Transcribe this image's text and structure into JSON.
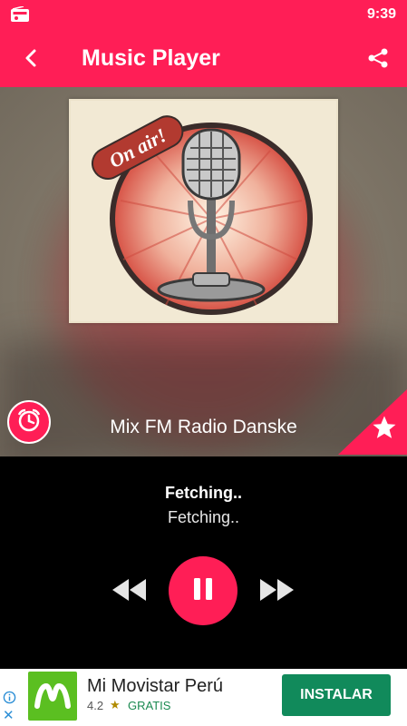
{
  "status_bar": {
    "time": "9:39",
    "icon": "radio-icon"
  },
  "app_bar": {
    "title": "Music Player",
    "back_icon": "chevron-left-icon",
    "share_icon": "share-icon"
  },
  "artwork": {
    "text": "On air!",
    "icon": "microphone"
  },
  "station": {
    "name": "Mix FM Radio Danske",
    "timer_icon": "alarm-clock-icon",
    "favorite_icon": "star-icon"
  },
  "player": {
    "title": "Fetching..",
    "subtitle": "Fetching..",
    "controls": {
      "rewind": "rewind-icon",
      "pause": "pause-icon",
      "forward": "fast-forward-icon"
    }
  },
  "ad": {
    "app_name": "Mi Movistar Perú",
    "rating": "4.2",
    "rating_icon": "★",
    "price": "GRATIS",
    "install_label": "INSTALAR"
  },
  "colors": {
    "accent": "#ff1e56",
    "install_green": "#118a5b",
    "ad_icon_green": "#5bbf21"
  }
}
